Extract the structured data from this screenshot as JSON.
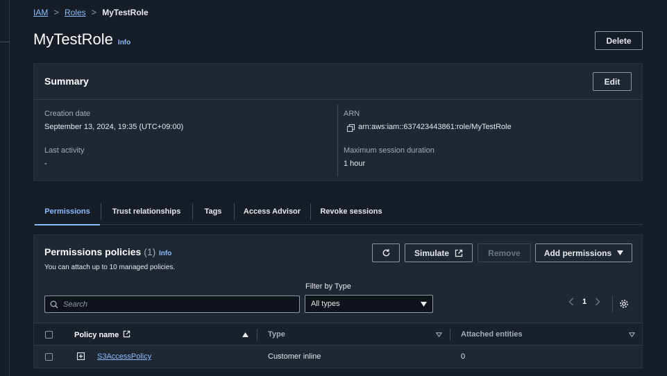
{
  "breadcrumb": {
    "items": [
      "IAM",
      "Roles"
    ],
    "current": "MyTestRole",
    "separator": ">"
  },
  "header": {
    "title": "MyTestRole",
    "info": "Info",
    "delete_label": "Delete"
  },
  "summary": {
    "title": "Summary",
    "edit_label": "Edit",
    "creation_date_label": "Creation date",
    "creation_date": "September 13, 2024, 19:35 (UTC+09:00)",
    "last_activity_label": "Last activity",
    "last_activity": "-",
    "arn_label": "ARN",
    "arn": "arn:aws:iam::637423443861:role/MyTestRole",
    "max_session_label": "Maximum session duration",
    "max_session": "1 hour"
  },
  "tabs": [
    {
      "label": "Permissions",
      "active": true
    },
    {
      "label": "Trust relationships",
      "active": false
    },
    {
      "label": "Tags",
      "active": false
    },
    {
      "label": "Access Advisor",
      "active": false
    },
    {
      "label": "Revoke sessions",
      "active": false
    }
  ],
  "permissions": {
    "title": "Permissions policies",
    "count": "(1)",
    "info": "Info",
    "description": "You can attach up to 10 managed policies.",
    "simulate_label": "Simulate",
    "remove_label": "Remove",
    "add_label": "Add permissions",
    "filter_label": "Filter by Type",
    "search_placeholder": "Search",
    "filter_value": "All types",
    "page": "1",
    "columns": [
      "Policy name",
      "Type",
      "Attached entities"
    ],
    "rows": [
      {
        "name": "S3AccessPolicy",
        "type": "Customer inline",
        "entities": "0"
      }
    ]
  },
  "colors": {
    "accent": "#89bdff",
    "background": "#161d26",
    "panel": "#1f2733"
  }
}
